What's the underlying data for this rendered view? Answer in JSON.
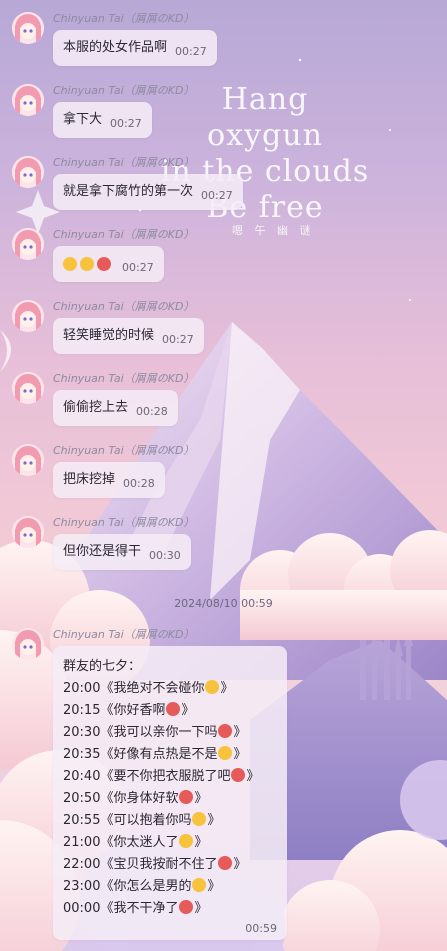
{
  "wallpaper": {
    "line1": "Hang oxygun",
    "line2": "in the clouds",
    "line3": "Be free",
    "sub": "嗯 午 幽 谜"
  },
  "sender_name": "Chinyuan Tai（屑屑のKD）",
  "messages": [
    {
      "text": "本服的处女作品啊",
      "time": "00:27"
    },
    {
      "text": "拿下大",
      "time": "00:27"
    },
    {
      "text": "就是拿下腐竹的第一次",
      "time": "00:27"
    },
    {
      "text": "",
      "time": "00:27",
      "emojis": [
        "grin-emoji",
        "laugh-emoji",
        "crazy-emoji"
      ]
    },
    {
      "text": "轻笑睡觉的时候",
      "time": "00:27"
    },
    {
      "text": "偷偷挖上去",
      "time": "00:28"
    },
    {
      "text": "把床挖掉",
      "time": "00:28"
    },
    {
      "text": "但你还是得干",
      "time": "00:30"
    }
  ],
  "date_separator": "2024/08/10 00:59",
  "long_message": {
    "header": "群友的七夕：",
    "lines": [
      {
        "text": "20:00《我绝对不会碰你",
        "emoji": "smile-emoji",
        "end": "》"
      },
      {
        "text": "20:15《你好香啊",
        "emoji": "kiss-heart-emoji",
        "end": "》"
      },
      {
        "text": "20:30《我可以亲你一下吗",
        "emoji": "heart-eyes-emoji",
        "end": "》"
      },
      {
        "text": "20:35《好像有点热是不是",
        "emoji": "sweat-emoji",
        "end": "》"
      },
      {
        "text": "20:40《要不你把衣服脱了吧",
        "emoji": "devil-emoji",
        "end": "》"
      },
      {
        "text": "20:50《你身体好软",
        "emoji": "flushed-emoji",
        "end": "》"
      },
      {
        "text": "20:55《可以抱着你吗",
        "emoji": "blush-emoji",
        "end": "》"
      },
      {
        "text": "21:00《你太迷人了",
        "emoji": "pleading-emoji",
        "end": "》"
      },
      {
        "text": "22:00《宝贝我按耐不住了",
        "emoji": "kiss-heart-emoji",
        "end": "》"
      },
      {
        "text": "23:00《你怎么是男的",
        "emoji": "shocked-emoji",
        "end": "》"
      },
      {
        "text": "00:00《我不干净了",
        "emoji": "crying-emoji",
        "end": "》"
      }
    ],
    "time": "00:59"
  },
  "colors": {
    "bubble": "#f4ecf6",
    "name": "#8f8aa1",
    "emoji_yellow": "#f7c23c",
    "emoji_red": "#e65a5a"
  }
}
